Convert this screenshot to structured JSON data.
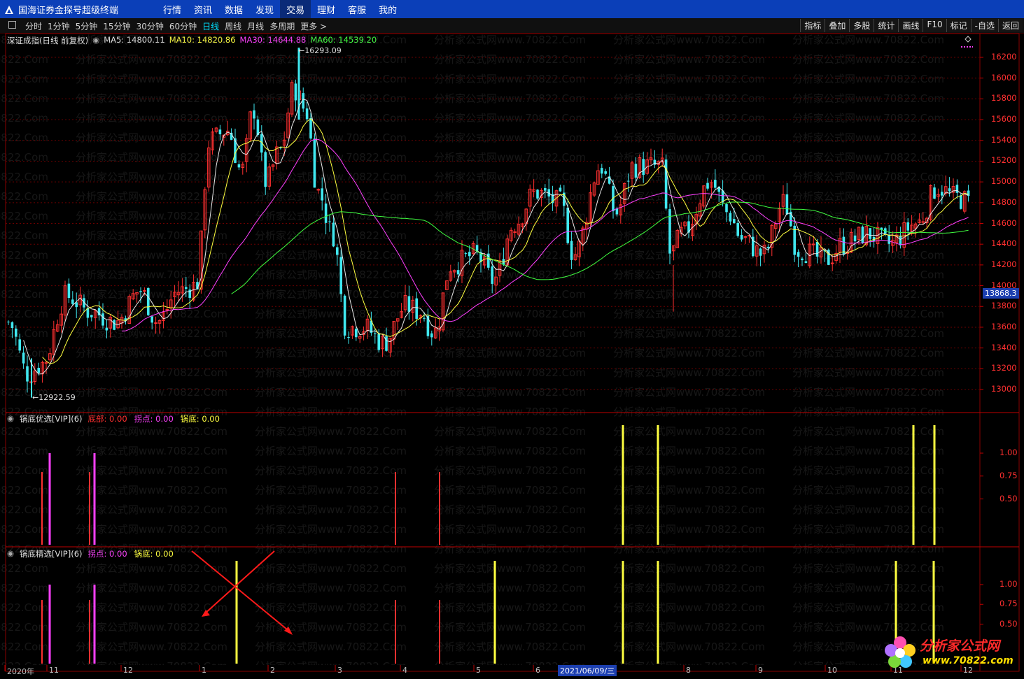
{
  "window": {
    "title": "国海证券金探号超级终端"
  },
  "menu": [
    "行情",
    "资讯",
    "数据",
    "发现",
    "交易",
    "理财",
    "客服",
    "我的"
  ],
  "menu_active": "交易",
  "periods": [
    "分时",
    "1分钟",
    "5分钟",
    "15分钟",
    "30分钟",
    "60分钟",
    "日线",
    "周线",
    "月线",
    "多周期",
    "更多 >"
  ],
  "period_selected": "日线",
  "right_tools": [
    "指标",
    "叠加",
    "多股",
    "统计",
    "画线",
    "F10",
    "标记",
    "-自选",
    "返回"
  ],
  "main_panel": {
    "symbol": "深证成指(日线 前复权)",
    "ma": [
      {
        "label": "MA5:",
        "value": "14800.11",
        "color": "#e0e0e0"
      },
      {
        "label": "MA10:",
        "value": "14820.86",
        "color": "#ffff40"
      },
      {
        "label": "MA30:",
        "value": "14644.88",
        "color": "#ff40ff"
      },
      {
        "label": "MA60:",
        "value": "14539.20",
        "color": "#40ff40"
      }
    ],
    "max_label": "16293.09",
    "min_label": "12922.59",
    "current_price": "13868.3",
    "y_ticks": [
      "16200",
      "16000",
      "15800",
      "15600",
      "15400",
      "15200",
      "15000",
      "14800",
      "14600",
      "14400",
      "14200",
      "14000",
      "13800",
      "13600",
      "13400",
      "13200",
      "13000"
    ]
  },
  "sub1": {
    "title": "锅底优选[VIP](6)",
    "items": [
      {
        "label": "底部:",
        "value": "0.00",
        "color": "#ff3030"
      },
      {
        "label": "拐点:",
        "value": "0.00",
        "color": "#ff40ff"
      },
      {
        "label": "锅底:",
        "value": "0.00",
        "color": "#ffff40"
      }
    ],
    "y_ticks": [
      "1.00",
      "0.75",
      "0.50"
    ]
  },
  "sub2": {
    "title": "锅底精选[VIP](6)",
    "items": [
      {
        "label": "拐点:",
        "value": "0.00",
        "color": "#ff40ff"
      },
      {
        "label": "锅底:",
        "value": "0.00",
        "color": "#ffff40"
      }
    ],
    "y_ticks": [
      "1.00",
      "0.75",
      "0.50"
    ]
  },
  "x_axis": [
    "2020年",
    "11",
    "12",
    "1",
    "2",
    "3",
    "4",
    "5",
    "6",
    "7",
    "8",
    "9",
    "10",
    "11",
    "12"
  ],
  "cursor_date": "2021/06/09/三",
  "watermark": "分析家公式网www.70822.Com",
  "brand": {
    "name": "分析家公式网",
    "url": "www.70822.com"
  }
}
